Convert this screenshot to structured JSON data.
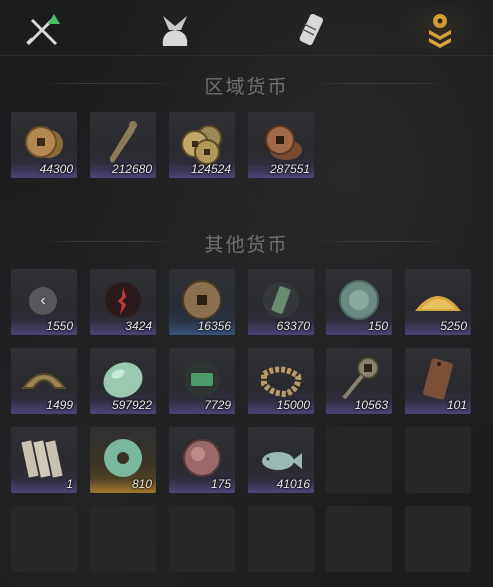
{
  "tabs": [
    {
      "icon": "swords-icon"
    },
    {
      "icon": "bundle-icon"
    },
    {
      "icon": "scroll-icon"
    },
    {
      "icon": "currency-icon",
      "active": true
    }
  ],
  "regional": {
    "title": "区域货币",
    "items": [
      {
        "icon": "copper-coins-icon",
        "count": "44300"
      },
      {
        "icon": "bronze-knife-coin-icon",
        "count": "212680"
      },
      {
        "icon": "brass-coins-icon",
        "count": "124524"
      },
      {
        "icon": "copper-coin-stack-icon",
        "count": "287551"
      }
    ]
  },
  "other": {
    "title": "其他货币",
    "items": [
      {
        "icon": "back-arrow-icon",
        "count": "1550"
      },
      {
        "icon": "red-sigil-icon",
        "count": "3424"
      },
      {
        "icon": "square-hole-coin-icon",
        "count": "16356"
      },
      {
        "icon": "jade-token-icon",
        "count": "63370"
      },
      {
        "icon": "jade-orb-icon",
        "count": "150"
      },
      {
        "icon": "gold-grain-pile-icon",
        "count": "5250"
      },
      {
        "icon": "half-coin-icon",
        "count": "1499"
      },
      {
        "icon": "jade-stone-icon",
        "count": "597922"
      },
      {
        "icon": "green-ticket-icon",
        "count": "7729"
      },
      {
        "icon": "coin-string-icon",
        "count": "15000"
      },
      {
        "icon": "spade-coin-icon",
        "count": "10563"
      },
      {
        "icon": "bronze-plaque-icon",
        "count": "101"
      },
      {
        "icon": "bamboo-slips-icon",
        "count": "1"
      },
      {
        "icon": "jade-bi-disc-icon",
        "count": "810"
      },
      {
        "icon": "red-jade-orb-icon",
        "count": "175"
      },
      {
        "icon": "jade-fish-icon",
        "count": "41016"
      }
    ]
  },
  "colors": {
    "background": "#1b1c1d",
    "purple_rarity": "#6e5aaa",
    "gold_rarity": "#c89632",
    "blue_rarity": "#466eaa",
    "active_tab": "#e0a83a"
  }
}
